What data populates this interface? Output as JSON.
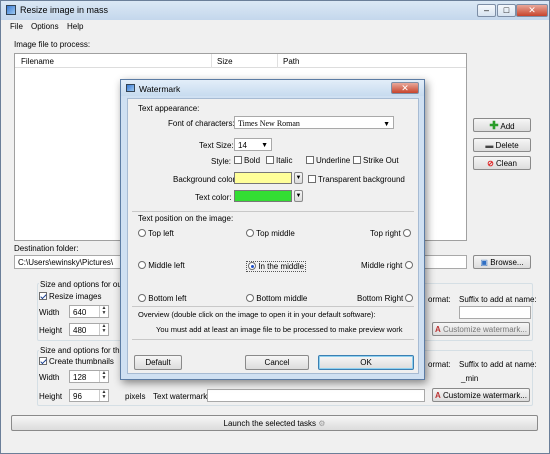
{
  "window": {
    "title": "Resize image in mass",
    "menu": [
      "File",
      "Options",
      "Help"
    ]
  },
  "main": {
    "image_file_label": "Image file to process:",
    "columns": [
      "Filename",
      "Size",
      "Path"
    ],
    "add": "Add",
    "delete": "Delete",
    "clean": "Clean",
    "destination_label": "Destination folder:",
    "destination_value": "C:\\Users\\ewinsky\\Pictures\\",
    "browse": "Browse...",
    "size_options_label": "Size and options for outpu",
    "resize_images": "Resize images",
    "width_label": "Width",
    "width_value": "640",
    "height_label": "Height",
    "height_value": "480",
    "format_label": "ormat:",
    "suffix_label": "Suffix to add at name:",
    "customize_watermark": "Customize watermark...",
    "thumb_options_label": "Size and options for thumb",
    "create_thumbnails": "Create thumbnails",
    "thumb_width_label": "Width",
    "thumb_width_value": "128",
    "thumb_height_label": "Height",
    "thumb_height_value": "96",
    "pixels": "pixels",
    "text_watermark_label": "Text watermark:",
    "thumb_format_label": "ormat:",
    "thumb_suffix_label": "Suffix to add at name:",
    "thumb_suffix_value": "_min",
    "launch": "Launch the selected tasks"
  },
  "dialog": {
    "title": "Watermark",
    "appearance_label": "Text appearance:",
    "font_label": "Font of characters:",
    "font_value": "Times New Roman",
    "size_label": "Text Size:",
    "size_value": "14",
    "style_label": "Style:",
    "styles": [
      "Bold",
      "Italic",
      "Underline",
      "Strike Out"
    ],
    "bg_color_label": "Background color:",
    "bg_color": "#ffff99",
    "transparent_label": "Transparent background",
    "text_color_label": "Text color:",
    "text_color": "#33dd33",
    "position_label": "Text position on the image:",
    "positions": [
      "Top left",
      "Top middle",
      "Top right",
      "Middle left",
      "In the middle",
      "Middle right",
      "Bottom left",
      "Bottom middle",
      "Bottom Right"
    ],
    "selected_position": "In the middle",
    "overview_label": "Overview (double click on the image to open it in your default software):",
    "overview_message": "You must add at least an image file to be processed to make preview work",
    "default": "Default",
    "cancel": "Cancel",
    "ok": "OK"
  }
}
